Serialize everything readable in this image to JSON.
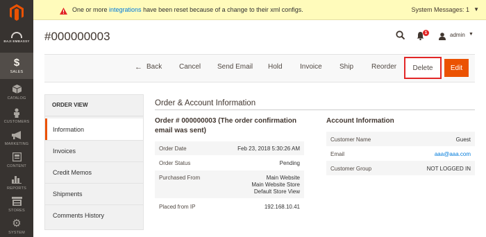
{
  "sidebar": {
    "brand_text": "BAJI EMBASSY",
    "items": [
      {
        "label": "SALES",
        "icon": "dollar-icon",
        "active": true
      },
      {
        "label": "CATALOG",
        "icon": "cube-icon"
      },
      {
        "label": "CUSTOMERS",
        "icon": "person-icon"
      },
      {
        "label": "MARKETING",
        "icon": "megaphone-icon"
      },
      {
        "label": "CONTENT",
        "icon": "layout-icon"
      },
      {
        "label": "REPORTS",
        "icon": "bar-chart-icon"
      },
      {
        "label": "STORES",
        "icon": "store-icon"
      },
      {
        "label": "SYSTEM",
        "icon": "gear-icon"
      }
    ]
  },
  "notice": {
    "prefix": "One or more ",
    "link": "integrations",
    "suffix": " have been reset because of a change to their xml configs.",
    "system_messages": "System Messages: 1"
  },
  "header": {
    "title": "#000000003",
    "notification_count": "1",
    "user": "admin"
  },
  "actions": {
    "back": "Back",
    "cancel": "Cancel",
    "send_email": "Send Email",
    "hold": "Hold",
    "invoice": "Invoice",
    "ship": "Ship",
    "reorder": "Reorder",
    "delete": "Delete",
    "edit": "Edit"
  },
  "order_nav": {
    "heading": "ORDER VIEW",
    "items": [
      "Information",
      "Invoices",
      "Credit Memos",
      "Shipments",
      "Comments History"
    ]
  },
  "main": {
    "section_title": "Order & Account Information",
    "order_title": "Order # 000000003 (The order confirmation email was sent)",
    "order_rows": [
      {
        "label": "Order Date",
        "value": "Feb 23, 2018 5:30:26 AM"
      },
      {
        "label": "Order Status",
        "value": "Pending"
      },
      {
        "label": "Purchased From",
        "value_lines": [
          "Main Website",
          "Main Website Store",
          "Default Store View"
        ]
      },
      {
        "label": "Placed from IP",
        "value": "192.168.10.41"
      }
    ],
    "account_title": "Account Information",
    "account_rows": [
      {
        "label": "Customer Name",
        "value": "Guest"
      },
      {
        "label": "Email",
        "value": "aaa@aaa.com"
      },
      {
        "label": "Customer Group",
        "value": "NOT LOGGED IN"
      }
    ]
  },
  "colors": {
    "sidebar_bg": "#373330",
    "accent": "#eb5202",
    "link": "#007bdb",
    "notice_bg": "#fffbbb",
    "highlight": "#e22626"
  }
}
